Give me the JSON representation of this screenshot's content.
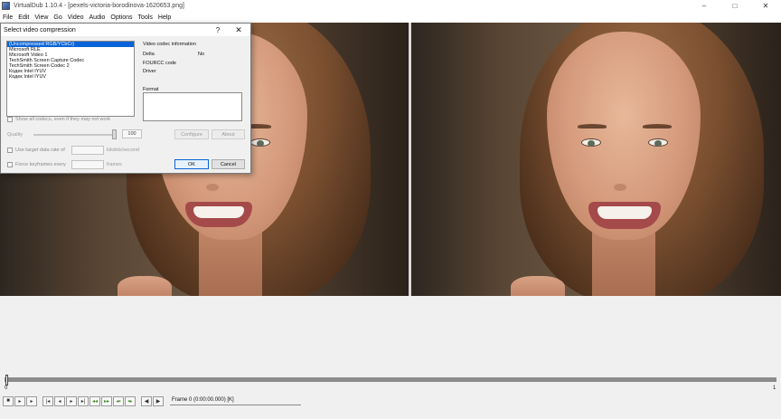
{
  "window": {
    "title": "VirtualDub 1.10.4 - [pexels-victoria-borodinova-1620653.png]",
    "min_glyph": "–",
    "max_glyph": "□",
    "close_glyph": "✕"
  },
  "menu": [
    "File",
    "Edit",
    "View",
    "Go",
    "Video",
    "Audio",
    "Options",
    "Tools",
    "Help"
  ],
  "dialog": {
    "title": "Select video compression",
    "help_glyph": "?",
    "close_glyph": "✕",
    "codecs": [
      "(Uncompressed RGB/YCbCr)",
      "Microsoft RLE",
      "Microsoft Video 1",
      "TechSmith Screen Capture Codec",
      "TechSmith Screen Codec 2",
      "Кодек Intel IYUV",
      "Кодек Intel IYUV"
    ],
    "selected_codec_index": 0,
    "info_heading": "Video codec information",
    "delta_label": "Delta",
    "delta_value": "No",
    "fourcc_label": "FOURCC code",
    "driver_label": "Driver",
    "format_label": "Format",
    "show_all_label": "Show all codecs, even if they may not work",
    "quality_label": "Quality",
    "quality_value": "100",
    "configure_label": "Configure",
    "about_label": "About",
    "target_rate_label": "Use target data rate of",
    "target_rate_unit": "kilobits/second",
    "keyframes_label": "Force keyframes every",
    "keyframes_unit": "frames",
    "ok_label": "OK",
    "cancel_label": "Cancel"
  },
  "timeline": {
    "start_label": "0",
    "end_label": "1",
    "position_fraction": 0.0,
    "frame_readout": "Frame 0 (0:00:00.000) [K]"
  },
  "toolbar": {
    "buttons": [
      "stop-icon",
      "play-input-icon",
      "play-output-icon",
      "start-icon",
      "prev-frame-icon",
      "next-frame-icon",
      "end-icon",
      "prev-keyframe-icon",
      "next-keyframe-icon",
      "scene-back-icon",
      "scene-fwd-icon",
      "mark-in-icon",
      "mark-out-icon"
    ],
    "glyphs": [
      "■",
      "▸",
      "▸",
      "|◂",
      "◂",
      "▸",
      "▸|",
      "◂◂",
      "▸▸",
      "◂▪",
      "▪▸",
      "◀",
      "▶"
    ]
  }
}
